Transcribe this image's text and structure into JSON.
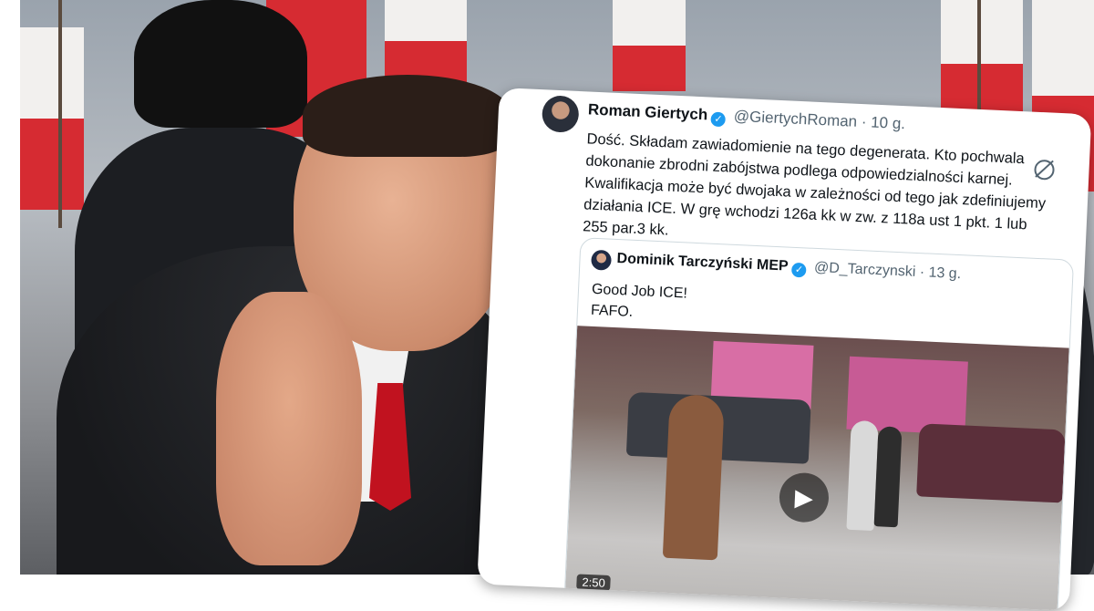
{
  "colors": {
    "flag_red": "#d62b32",
    "tie_red": "#c1121f",
    "verified_blue": "#1d9bf0",
    "text_primary": "#0f1419",
    "text_secondary": "#536471"
  },
  "tweet": {
    "author_name": "Roman Giertych",
    "author_handle": "@GiertychRoman",
    "separator": "·",
    "time": "10 g.",
    "verified_icon": "✓",
    "text": "Dość. Składam zawiadomienie na tego degenerata. Kto pochwala dokonanie zbrodni zabójstwa podlega odpowiedzialności karnej. Kwalifikacja może być dwojaka w zależności od tego jak zdefiniujemy działania ICE. W grę wchodzi 126a kk w zw. z 118a ust 1 pkt. 1 lub 255 par.3 kk.",
    "grok_icon": "grok-icon"
  },
  "quoted_tweet": {
    "author_name": "Dominik Tarczyński MEP",
    "author_handle": "@D_Tarczynski",
    "separator": "·",
    "time": "13 g.",
    "verified_icon": "✓",
    "line1": "Good Job ICE!",
    "line2": "FAFO.",
    "video": {
      "play_icon": "▶",
      "duration": "2:50"
    }
  }
}
